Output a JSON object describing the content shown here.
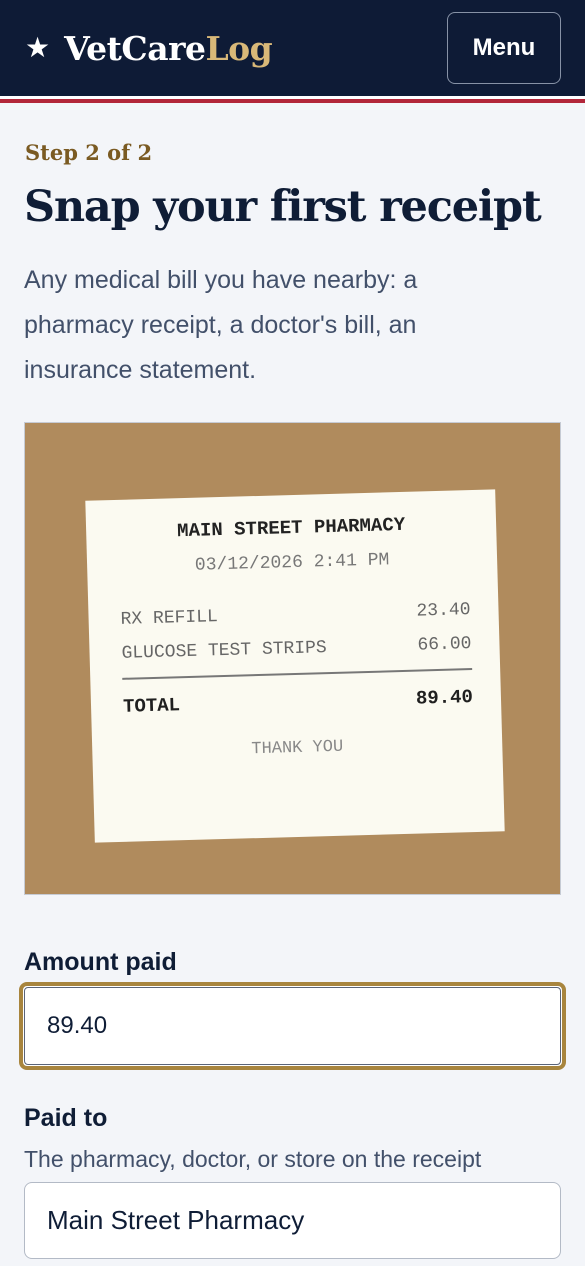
{
  "header": {
    "star": "★",
    "brand_a": "VetCare",
    "brand_b": "Log",
    "menu_label": "Menu"
  },
  "step_text": "Step 2 of 2",
  "title": "Snap your first receipt",
  "subtitle": "Any medical bill you have nearby: a pharmacy receipt, a doctor's bill, an insurance statement.",
  "receipt": {
    "store": "MAIN STREET PHARMACY",
    "datetime": "03/12/2026 2:41 PM",
    "items": [
      {
        "name": "RX REFILL",
        "amount": "23.40"
      },
      {
        "name": "GLUCOSE TEST STRIPS",
        "amount": "66.00"
      }
    ],
    "total_label": "TOTAL",
    "total_amount": "89.40",
    "thanks": "THANK YOU"
  },
  "form": {
    "amount_label": "Amount paid",
    "amount_value": "89.40",
    "paid_to_label": "Paid to",
    "paid_to_hint": "The pharmacy, doctor, or store on the receipt",
    "paid_to_value": "Main Street Pharmacy"
  },
  "colors": {
    "navy": "#0e1b36",
    "gold": "#d8b878",
    "red_stripe": "#b2263a",
    "focus_ring": "#a8853e"
  }
}
